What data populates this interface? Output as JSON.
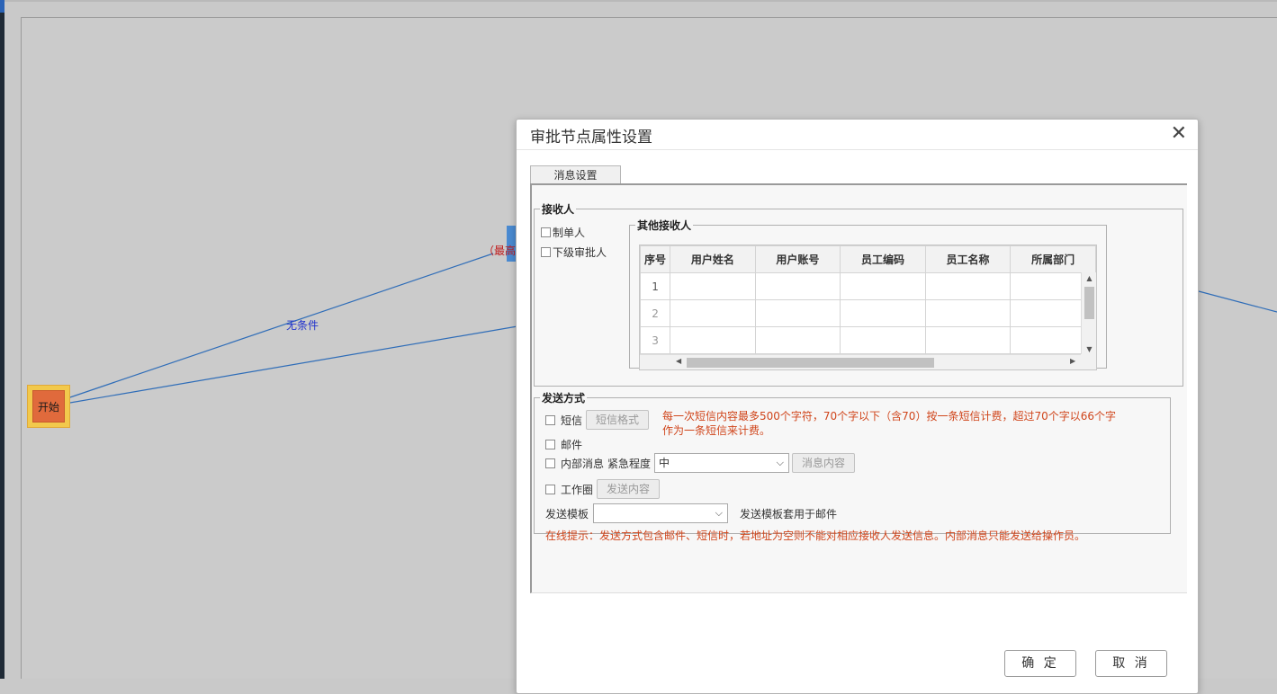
{
  "flow": {
    "start_label": "开始",
    "edge_label_none": "无条件",
    "edge_label_highest": "（最高"
  },
  "dialog": {
    "title": "审批节点属性设置",
    "close_symbol": "✕",
    "tab_label": "消息设置",
    "receivers": {
      "legend": "接收人",
      "creator": "制单人",
      "next_approver": "下级审批人",
      "others_legend": "其他接收人",
      "columns": [
        "序号",
        "用户姓名",
        "用户账号",
        "员工编码",
        "员工名称",
        "所属部门"
      ],
      "rows": [
        "1",
        "2",
        "3"
      ]
    },
    "send": {
      "legend": "发送方式",
      "sms": "短信",
      "sms_format_button": "短信格式",
      "sms_note_line1": "每一次短信内容最多500个字符，70个字以下（含70）按一条短信计费，超过70个字以66个字",
      "sms_note_line2": "作为一条短信来计费。",
      "mail": "邮件",
      "internal": "内部消息",
      "urgency_label": "紧急程度",
      "urgency_value": "中",
      "message_content_button": "消息内容",
      "workcircle": "工作圈",
      "send_content_button": "发送内容",
      "template_label": "发送模板",
      "template_value": "",
      "template_note": "发送模板套用于邮件",
      "online_tip": "在线提示：发送方式包含邮件、短信时，若地址为空则不能对相应接收人发送信息。内部消息只能发送给操作员。"
    },
    "ok_button": "确 定",
    "cancel_button": "取 消"
  },
  "colors": {
    "edge": "#2f6db8",
    "start_outer": "#f2c94c",
    "start_inner": "#e06a3c",
    "hint_red": "#d0451b"
  }
}
